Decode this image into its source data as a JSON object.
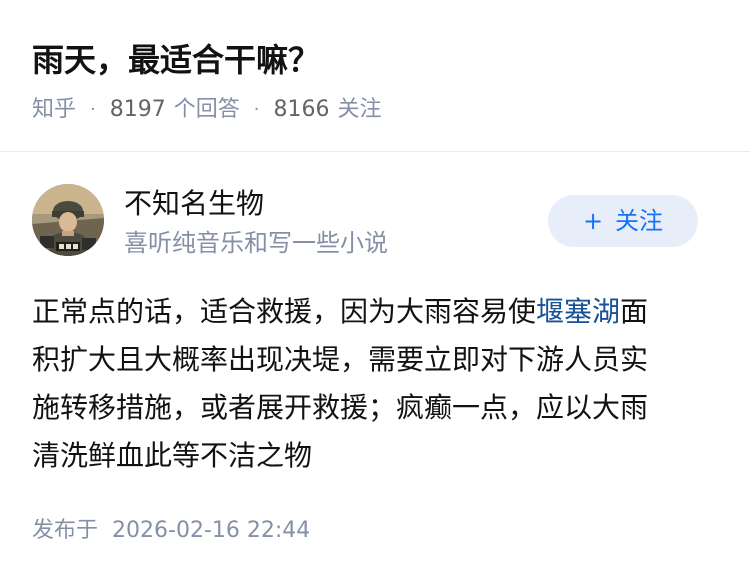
{
  "question": {
    "title": "雨天，最适合干嘛？",
    "source": "知乎",
    "answer_count": "8197",
    "answer_label": "个回答",
    "follower_count": "8166",
    "follower_label": "关注",
    "separator": "·"
  },
  "author": {
    "name": "不知名生物",
    "bio": "喜听纯音乐和写一些小说",
    "avatar_icon": "soldier-portrait-avatar"
  },
  "follow_button": {
    "plus": "+",
    "label": "关注"
  },
  "answer": {
    "line1_before": "正常点的话，适合救援，因为大雨容易使",
    "line1_link": "堰塞湖",
    "line1_after": "面",
    "line2": "积扩大且大概率出现决堤，需要立即对下游人员实",
    "line3": "施转移措施，或者展开救援；疯癫一点，应以大雨",
    "line4": "清洗鲜血此等不洁之物"
  },
  "publish": {
    "label": "发布于",
    "datetime": "2026-02-16 22:44"
  },
  "colors": {
    "title": "#121212",
    "meta": "#8590a6",
    "link": "#175199",
    "button_bg": "#e7eef9",
    "button_text": "#1772f6"
  }
}
